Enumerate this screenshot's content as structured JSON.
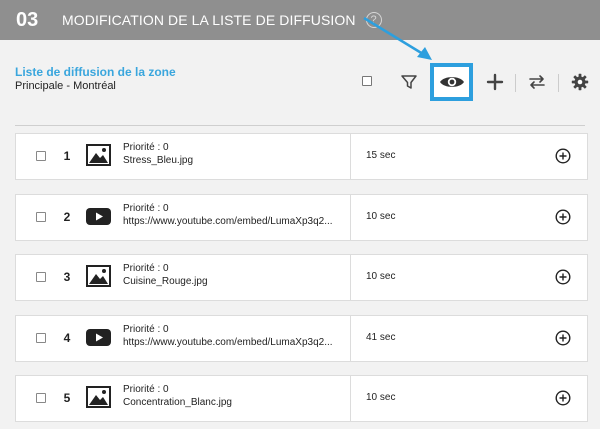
{
  "header": {
    "step": "03",
    "title": "MODIFICATION DE LA LISTE DE DIFFUSION",
    "help_icon": "?"
  },
  "zone": {
    "title": "Liste de diffusion de la zone",
    "subtitle": "Principale - Montréal"
  },
  "toolbar": {
    "icons": [
      "checkbox",
      "filter-icon",
      "eye-icon",
      "plus-icon",
      "swap-icon",
      "gear-icon"
    ],
    "highlight_color": "#2d9fde"
  },
  "rows": [
    {
      "number": "1",
      "type": "image",
      "priority": "Priorité : 0",
      "file": "Stress_Bleu.jpg",
      "duration": "15 sec"
    },
    {
      "number": "2",
      "type": "video",
      "priority": "Priorité : 0",
      "file": "https://www.youtube.com/embed/LumaXp3q2...",
      "duration": "10 sec"
    },
    {
      "number": "3",
      "type": "image",
      "priority": "Priorité : 0",
      "file": "Cuisine_Rouge.jpg",
      "duration": "10 sec"
    },
    {
      "number": "4",
      "type": "video",
      "priority": "Priorité : 0",
      "file": "https://www.youtube.com/embed/LumaXp3q2...",
      "duration": "41 sec"
    },
    {
      "number": "5",
      "type": "image",
      "priority": "Priorité : 0",
      "file": "Concentration_Blanc.jpg",
      "duration": "10 sec"
    }
  ],
  "colors": {
    "header_bg": "#8f8f8f",
    "zone_title": "#3aa6dd",
    "accent_arrow": "#2d9fde"
  }
}
